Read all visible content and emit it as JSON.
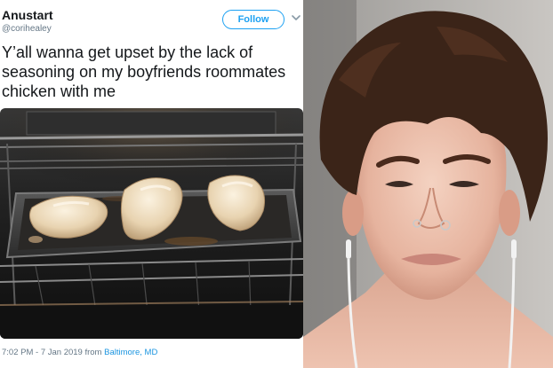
{
  "tweet": {
    "display_name": "Anustart",
    "handle": "@corihealey",
    "follow_label": "Follow",
    "text_lines": [
      "Y’all wanna get upset by the lack of",
      "seasoning on my boyfriends roommates",
      "chicken with me"
    ],
    "timestamp": "7:02 PM - 7 Jan 2019 from ",
    "location": "Baltimore, MD",
    "accent_color": "#1da1f2"
  },
  "icons": {
    "menu": "chevron-down-icon"
  }
}
